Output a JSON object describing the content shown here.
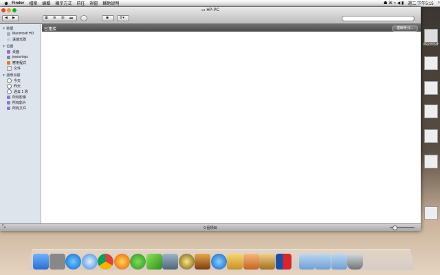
{
  "menubar": {
    "apple_icon": "apple-icon",
    "items": [
      "Finder",
      "檔案",
      "編輯",
      "顯示方式",
      "前往",
      "視窗",
      "輔助說明"
    ],
    "clock": "週二 下午5:15"
  },
  "window": {
    "title": "HP-PC",
    "search_placeholder": "",
    "path_label": "已連接",
    "path_button": "連線身分...",
    "status": "0 個項目"
  },
  "sidebar": {
    "sections": [
      {
        "title": "裝置",
        "items": [
          {
            "label": "Macintosh HD",
            "icon": "hard-drive-icon"
          },
          {
            "label": "遠端光碟",
            "icon": "remote-disc-icon"
          }
        ]
      },
      {
        "title": "位置",
        "items": [
          {
            "label": "桌面",
            "icon": "desktop-folder-icon"
          },
          {
            "label": "jeansrings",
            "icon": "home-icon"
          },
          {
            "label": "應用程式",
            "icon": "applications-icon"
          },
          {
            "label": "文件",
            "icon": "documents-icon"
          }
        ]
      },
      {
        "title": "搜尋目標",
        "items": [
          {
            "label": "今天",
            "icon": "clock-icon"
          },
          {
            "label": "昨天",
            "icon": "clock-icon"
          },
          {
            "label": "過去 1 週",
            "icon": "clock-icon"
          },
          {
            "label": "所有影像",
            "icon": "smart-folder-icon"
          },
          {
            "label": "所有影片",
            "icon": "smart-folder-icon"
          },
          {
            "label": "所有文件",
            "icon": "smart-folder-icon"
          }
        ]
      }
    ]
  },
  "desktop": {
    "icons": [
      {
        "label": "Macintosh HD"
      },
      {
        "label": ""
      },
      {
        "label": ""
      },
      {
        "label": ""
      },
      {
        "label": ""
      },
      {
        "label": ""
      },
      {
        "label": ""
      }
    ]
  },
  "dock": {
    "apps": [
      "finder-icon",
      "system-preferences-icon",
      "app-store-icon",
      "safari-icon",
      "chrome-icon",
      "firefox-icon",
      "robot-icon",
      "x-app-icon",
      "iphoto-icon",
      "imovie-icon",
      "garageband-icon",
      "itunes-icon",
      "mail-icon",
      "preview-icon",
      "stickies-icon",
      "photo-booth-icon",
      "dashboard-icon",
      "applications-folder-icon",
      "documents-folder-icon",
      "downloads-folder-icon",
      "trash-icon"
    ]
  },
  "colors": {
    "sidebar": "#dee4ec",
    "pathbar": "#5a5a5a",
    "close": "#e0443e",
    "min": "#dea123",
    "zoom": "#1aab29"
  }
}
